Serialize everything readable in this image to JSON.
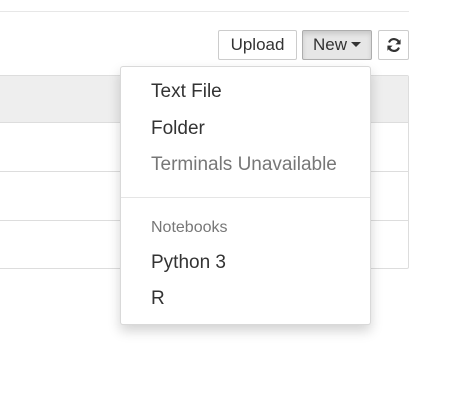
{
  "toolbar": {
    "upload_label": "Upload",
    "new_label": "New",
    "refresh_icon": "refresh-icon"
  },
  "new_menu": {
    "items": [
      {
        "label": "Text File",
        "enabled": true
      },
      {
        "label": "Folder",
        "enabled": true
      },
      {
        "label": "Terminals Unavailable",
        "enabled": false
      }
    ],
    "notebooks_header": "Notebooks",
    "kernels": [
      {
        "label": "Python 3"
      },
      {
        "label": "R"
      }
    ]
  },
  "colors": {
    "border": "#cccccc",
    "active_button_bg": "#e6e6e6",
    "list_header_bg": "#eeeeee",
    "disabled_text": "#777777"
  }
}
